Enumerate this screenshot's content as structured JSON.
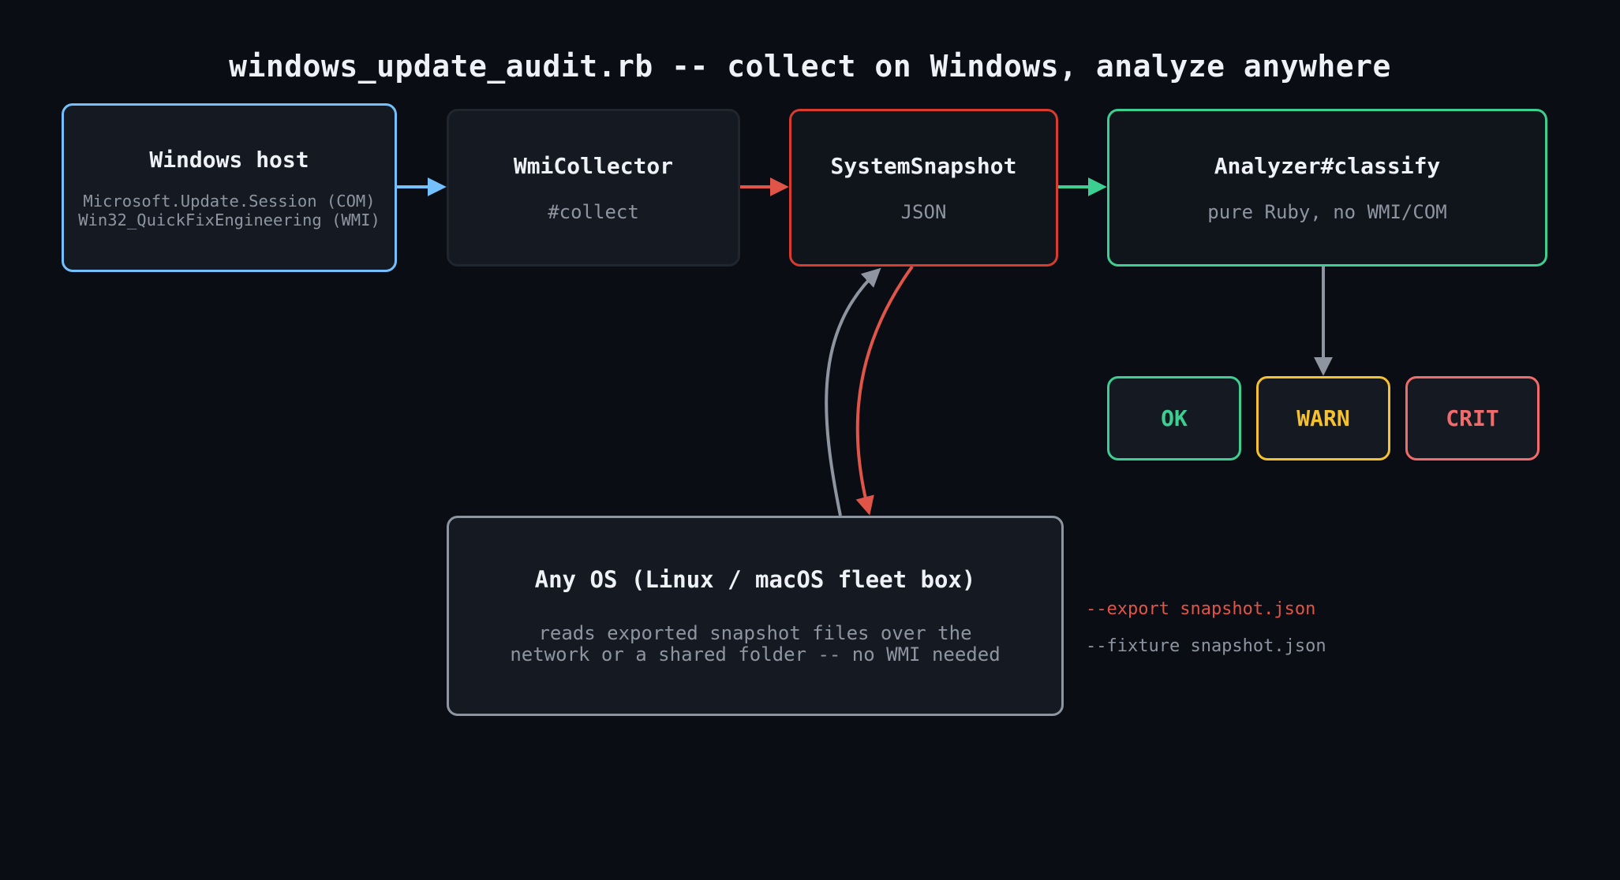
{
  "title": "windows_update_audit.rb -- collect on Windows, analyze anywhere",
  "nodes": {
    "windows_host": {
      "name": "Windows host",
      "detail": "Microsoft.Update.Session (COM)\nWin32_QuickFixEngineering (WMI)"
    },
    "wmi_collector": {
      "name": "WmiCollector",
      "detail": "#collect"
    },
    "system_snapshot": {
      "name": "SystemSnapshot",
      "detail": "JSON"
    },
    "analyzer": {
      "name": "Analyzer#classify",
      "detail": "pure Ruby, no WMI/COM"
    },
    "any_os": {
      "name": "Any OS (Linux / macOS fleet box)",
      "detail": "reads exported snapshot files over the\nnetwork or a shared folder -- no WMI needed"
    }
  },
  "statuses": {
    "ok": "OK",
    "warn": "WARN",
    "crit": "CRIT"
  },
  "flags": {
    "export": "--export snapshot.json",
    "fixture": "--fixture snapshot.json"
  },
  "colors": {
    "background": "#0a0d13",
    "windows": "#74c0fc",
    "snapshot": "#d73c2f",
    "analyzer": "#3ccf91",
    "neutral": "#8e95a1",
    "ok": "#3ccf91",
    "warn": "#f5c12e",
    "crit": "#f26b6b",
    "export_arrow": "#e05548"
  }
}
